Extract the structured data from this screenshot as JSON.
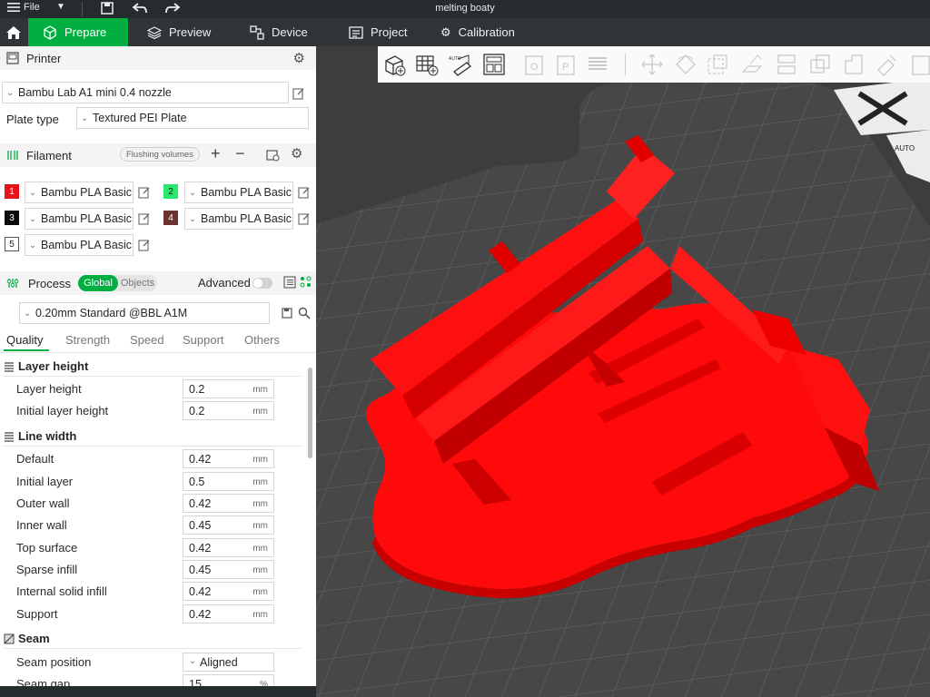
{
  "titlebar": {
    "file_label": "File",
    "window_title": "melting boaty"
  },
  "tabs": [
    {
      "label": "Prepare",
      "icon": "cube-outline-icon",
      "active": true
    },
    {
      "label": "Preview",
      "icon": "layers-icon",
      "active": false
    },
    {
      "label": "Device",
      "icon": "device-icon",
      "active": false
    },
    {
      "label": "Project",
      "icon": "project-icon",
      "active": false
    },
    {
      "label": "Calibration",
      "icon": "gear-icon",
      "active": false
    }
  ],
  "printer": {
    "section_label": "Printer",
    "selected": "Bambu Lab A1 mini 0.4 nozzle",
    "plate_label": "Plate type",
    "plate_value": "Textured PEI Plate"
  },
  "filament": {
    "section_label": "Filament",
    "flushing_label": "Flushing volumes",
    "slots": [
      {
        "num": "1",
        "color": "#e8141b",
        "name": "Bambu PLA Basic"
      },
      {
        "num": "2",
        "color": "#27e86a",
        "name": "Bambu PLA Basic"
      },
      {
        "num": "3",
        "color": "#0a0a0a",
        "name": "Bambu PLA Basic"
      },
      {
        "num": "4",
        "color": "#6a3330",
        "name": "Bambu PLA Basic"
      },
      {
        "num": "5",
        "color": "#ffffff",
        "name": "Bambu PLA Basic"
      }
    ]
  },
  "process": {
    "section_label": "Process",
    "global_label": "Global",
    "objects_label": "Objects",
    "advanced_label": "Advanced",
    "preset": "0.20mm Standard @BBL A1M",
    "subtabs": [
      "Quality",
      "Strength",
      "Speed",
      "Support",
      "Others"
    ],
    "groups": {
      "layer_height": {
        "title": "Layer height",
        "rows": [
          {
            "label": "Layer height",
            "value": "0.2",
            "unit": "mm"
          },
          {
            "label": "Initial layer height",
            "value": "0.2",
            "unit": "mm"
          }
        ]
      },
      "line_width": {
        "title": "Line width",
        "rows": [
          {
            "label": "Default",
            "value": "0.42",
            "unit": "mm"
          },
          {
            "label": "Initial layer",
            "value": "0.5",
            "unit": "mm"
          },
          {
            "label": "Outer wall",
            "value": "0.42",
            "unit": "mm"
          },
          {
            "label": "Inner wall",
            "value": "0.45",
            "unit": "mm"
          },
          {
            "label": "Top surface",
            "value": "0.42",
            "unit": "mm"
          },
          {
            "label": "Sparse infill",
            "value": "0.45",
            "unit": "mm"
          },
          {
            "label": "Internal solid infill",
            "value": "0.42",
            "unit": "mm"
          },
          {
            "label": "Support",
            "value": "0.42",
            "unit": "mm"
          }
        ]
      },
      "seam": {
        "title": "Seam",
        "rows": [
          {
            "label": "Seam position",
            "value": "Aligned",
            "unit": ""
          },
          {
            "label": "Seam gap",
            "value": "15",
            "unit": "%"
          }
        ]
      }
    }
  },
  "viewport": {
    "auto_label": "AUTO",
    "model_color": "#ff0a0a",
    "plate_color": "#444444"
  }
}
